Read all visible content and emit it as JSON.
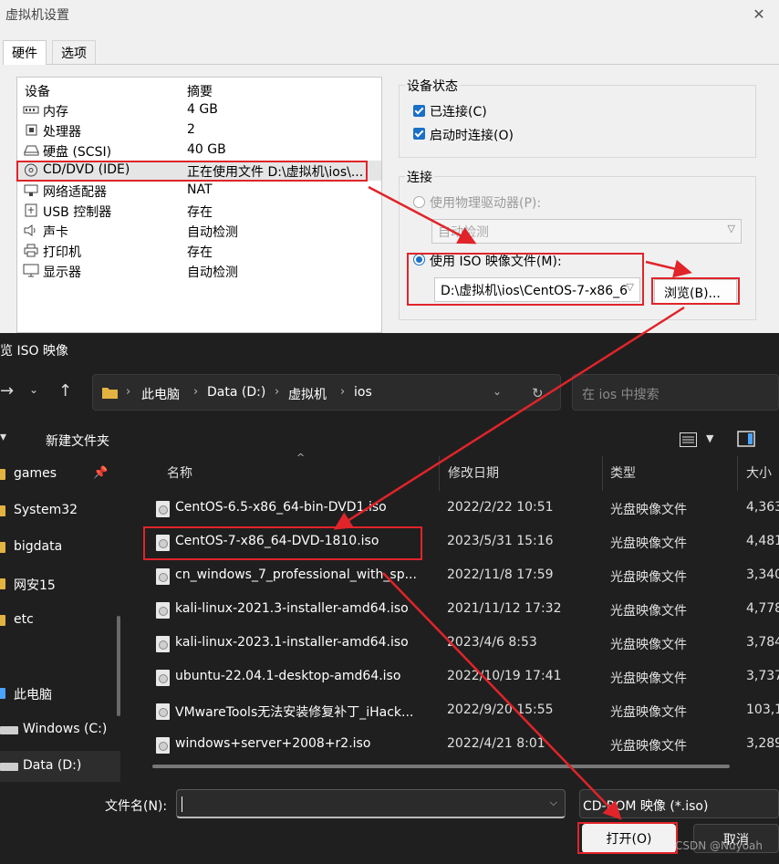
{
  "vm_dialog": {
    "title": "虚拟机设置",
    "close": "✕",
    "tabs": [
      "硬件",
      "选项"
    ],
    "device_list": {
      "col_device": "设备",
      "col_summary": "摘要",
      "rows": [
        {
          "name": "内存",
          "summary": "4 GB",
          "icon": "memory-icon"
        },
        {
          "name": "处理器",
          "summary": "2",
          "icon": "cpu-icon"
        },
        {
          "name": "硬盘 (SCSI)",
          "summary": "40 GB",
          "icon": "harddisk-icon"
        },
        {
          "name": "CD/DVD (IDE)",
          "summary": "正在使用文件 D:\\虚拟机\\ios\\...",
          "icon": "cd-icon"
        },
        {
          "name": "网络适配器",
          "summary": "NAT",
          "icon": "network-icon"
        },
        {
          "name": "USB 控制器",
          "summary": "存在",
          "icon": "usb-icon"
        },
        {
          "name": "声卡",
          "summary": "自动检测",
          "icon": "speaker-icon"
        },
        {
          "name": "打印机",
          "summary": "存在",
          "icon": "printer-icon"
        },
        {
          "name": "显示器",
          "summary": "自动检测",
          "icon": "monitor-icon"
        }
      ]
    },
    "device_status": {
      "label": "设备状态",
      "connected": "已连接(C)",
      "connect_on_start": "启动时连接(O)"
    },
    "connection": {
      "label": "连接",
      "physical_drive": "使用物理驱动器(P):",
      "physical_value": "自动检测",
      "iso_file": "使用 ISO 映像文件(M):",
      "iso_path": "D:\\虚拟机\\ios\\CentOS-7-x86_6",
      "browse": "浏览(B)..."
    }
  },
  "file_dialog": {
    "title": "览 ISO 映像",
    "breadcrumb": [
      "此电脑",
      "Data (D:)",
      "虚拟机",
      "ios"
    ],
    "search_placeholder": "在 ios 中搜索",
    "new_folder": "新建文件夹",
    "sidebar": [
      "games",
      "System32",
      "bigdata",
      "网安15",
      "etc",
      "此电脑",
      "Windows (C:)",
      "Data (D:)"
    ],
    "columns": {
      "name": "名称",
      "date": "修改日期",
      "type": "类型",
      "size": "大小"
    },
    "files": [
      {
        "name": "CentOS-6.5-x86_64-bin-DVD1.iso",
        "date": "2022/2/22 10:51",
        "type": "光盘映像文件",
        "size": "4,363"
      },
      {
        "name": "CentOS-7-x86_64-DVD-1810.iso",
        "date": "2023/5/31 15:16",
        "type": "光盘映像文件",
        "size": "4,481"
      },
      {
        "name": "cn_windows_7_professional_with_sp...",
        "date": "2022/11/8 17:59",
        "type": "光盘映像文件",
        "size": "3,340"
      },
      {
        "name": "kali-linux-2021.3-installer-amd64.iso",
        "date": "2021/11/12 17:32",
        "type": "光盘映像文件",
        "size": "4,778"
      },
      {
        "name": "kali-linux-2023.1-installer-amd64.iso",
        "date": "2023/4/6 8:53",
        "type": "光盘映像文件",
        "size": "3,784"
      },
      {
        "name": "ubuntu-22.04.1-desktop-amd64.iso",
        "date": "2022/10/19 17:41",
        "type": "光盘映像文件",
        "size": "3,737"
      },
      {
        "name": "VMwareTools无法安装修复补丁_iHack...",
        "date": "2022/9/20 15:55",
        "type": "光盘映像文件",
        "size": "103,1"
      },
      {
        "name": "windows+server+2008+r2.iso",
        "date": "2022/4/21 8:01",
        "type": "光盘映像文件",
        "size": "3,289"
      }
    ],
    "filename_label": "文件名(N):",
    "filename_value": "",
    "filter": "CD-ROM 映像 (*.iso)",
    "open": "打开(O)",
    "cancel": "取消"
  },
  "watermark": "CSDN @Nuyoah",
  "colors": {
    "highlight": "#e0242a",
    "accent": "#1a6fc7",
    "dark_bg": "#1f1f1f"
  }
}
